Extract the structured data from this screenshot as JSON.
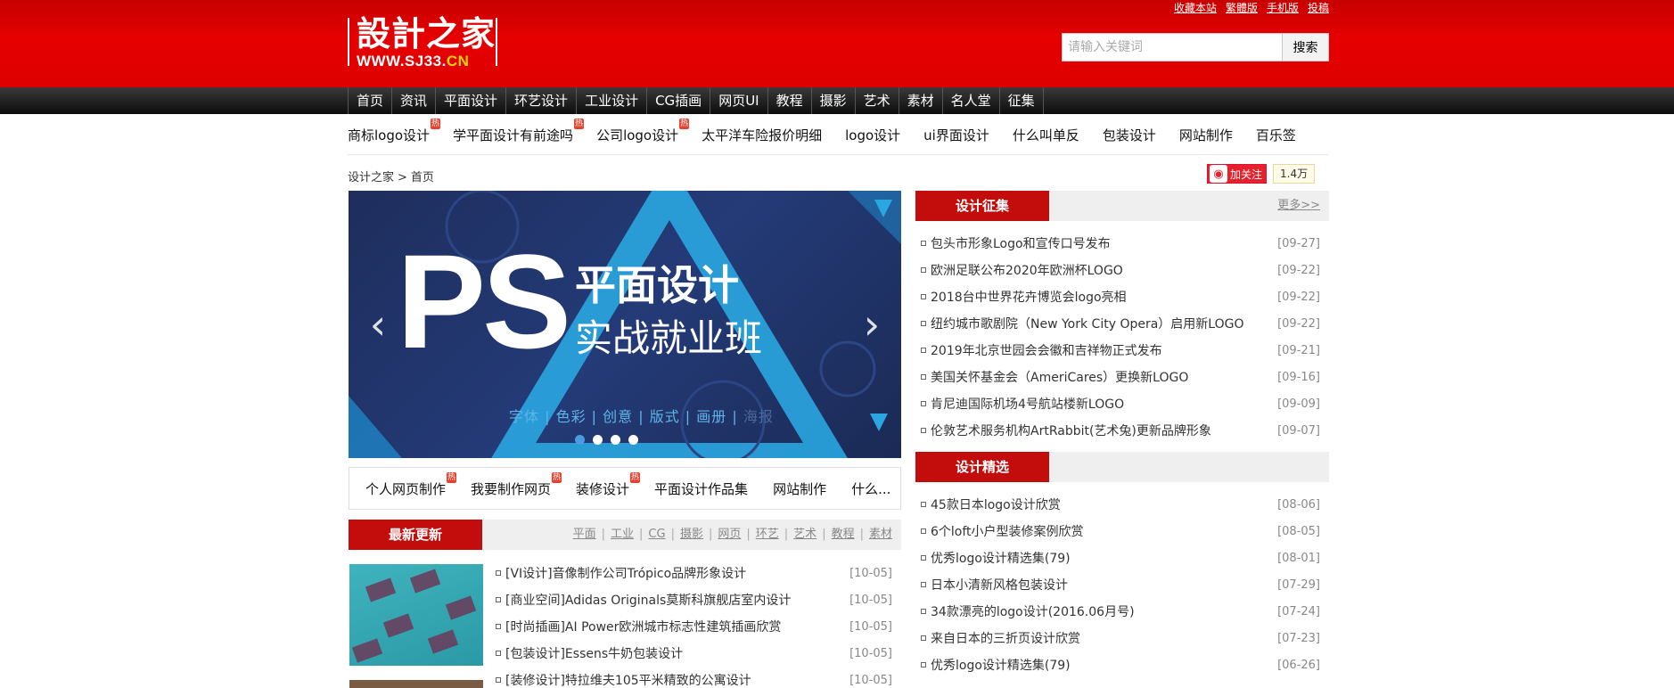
{
  "topbar": [
    "收藏本站",
    "繁體版",
    "手机版",
    "投稿"
  ],
  "logo": {
    "cn": "設計之家",
    "en_prefix": "WWW.SJ33.",
    "en_suffix": "CN"
  },
  "search": {
    "placeholder": "请输入关键词",
    "button": "搜索"
  },
  "nav": [
    "首页",
    "资讯",
    "平面设计",
    "环艺设计",
    "工业设计",
    "CG插画",
    "网页UI",
    "教程",
    "摄影",
    "艺术",
    "素材",
    "名人堂",
    "征集"
  ],
  "keywords": [
    {
      "label": "商标logo设计",
      "hot": "热"
    },
    {
      "label": "学平面设计有前途吗",
      "hot": "热"
    },
    {
      "label": "公司logo设计",
      "hot": "热"
    },
    {
      "label": "太平洋车险报价明细",
      "hot": ""
    },
    {
      "label": "logo设计",
      "hot": ""
    },
    {
      "label": "ui界面设计",
      "hot": ""
    },
    {
      "label": "什么叫单反",
      "hot": ""
    },
    {
      "label": "包装设计",
      "hot": ""
    },
    {
      "label": "网站制作",
      "hot": ""
    },
    {
      "label": "百乐签",
      "hot": ""
    }
  ],
  "breadcrumb": {
    "home": "设计之家",
    "sep": ">",
    "current": "首页"
  },
  "follow": {
    "icon": "weibo-icon",
    "label": "加关注",
    "count": "1.4万"
  },
  "banner": {
    "big": "PS",
    "title1": "平面设计",
    "title2": "实战就业班",
    "tags": "字体 | 色彩 | 创意 | 版式 | 画册 | ",
    "tags_dim": "海报",
    "prev": "‹",
    "next": "›"
  },
  "subkeywords": [
    {
      "label": "个人网页制作",
      "hot": "热"
    },
    {
      "label": "我要制作网页",
      "hot": "热"
    },
    {
      "label": "装修设计",
      "hot": "热"
    },
    {
      "label": "平面设计作品集",
      "hot": ""
    },
    {
      "label": "网站制作",
      "hot": ""
    },
    {
      "label": "什么...",
      "hot": ""
    }
  ],
  "latest": {
    "title": "最新更新",
    "categories": [
      "平面",
      "工业",
      "CG",
      "摄影",
      "网页",
      "环艺",
      "艺术",
      "教程",
      "素材"
    ],
    "items": [
      {
        "text": "[VI设计]音像制作公司Trópico品牌形象设计",
        "date": "[10-05]"
      },
      {
        "text": "[商业空间]Adidas Originals莫斯科旗舰店室内设计",
        "date": "[10-05]"
      },
      {
        "text": "[时尚插画]AI Power欧洲城市标志性建筑插画欣赏",
        "date": "[10-05]"
      },
      {
        "text": "[包装设计]Essens牛奶包装设计",
        "date": "[10-05]"
      },
      {
        "text": "[装修设计]特拉维夫105平米精致的公寓设计",
        "date": "[10-05]"
      }
    ]
  },
  "collect": {
    "title": "设计征集",
    "more": "更多>>",
    "items": [
      {
        "text": "包头市形象Logo和宣传口号发布",
        "date": "[09-27]"
      },
      {
        "text": "欧洲足联公布2020年欧洲杯LOGO",
        "date": "[09-22]"
      },
      {
        "text": "2018台中世界花卉博览会logo亮相",
        "date": "[09-22]"
      },
      {
        "text": "纽约城市歌剧院（New York City Opera）启用新LOGO",
        "date": "[09-22]"
      },
      {
        "text": "2019年北京世园会会徽和吉祥物正式发布",
        "date": "[09-21]"
      },
      {
        "text": "美国关怀基金会（AmeriCares）更换新LOGO",
        "date": "[09-16]"
      },
      {
        "text": "肯尼迪国际机场4号航站楼新LOGO",
        "date": "[09-09]"
      },
      {
        "text": "伦敦艺术服务机构ArtRabbit(艺术兔)更新品牌形象",
        "date": "[09-07]"
      }
    ]
  },
  "selected": {
    "title": "设计精选",
    "items": [
      {
        "text": "45款日本logo设计欣赏",
        "date": "[08-06]"
      },
      {
        "text": "6个loft小户型装修案例欣赏",
        "date": "[08-05]"
      },
      {
        "text": "优秀logo设计精选集(79)",
        "date": "[08-01]"
      },
      {
        "text": "日本小清新风格包装设计",
        "date": "[07-29]"
      },
      {
        "text": "34款漂亮的logo设计(2016.06月号)",
        "date": "[07-24]"
      },
      {
        "text": "来自日本的三折页设计欣赏",
        "date": "[07-23]"
      },
      {
        "text": "优秀logo设计精选集(79)",
        "date": "[06-26]"
      }
    ]
  },
  "colors": {
    "brand_red": "#dd0000",
    "section_red": "#c30d0d",
    "nav_dark": "#1a1a1a",
    "hot_badge": "#e8412d"
  }
}
